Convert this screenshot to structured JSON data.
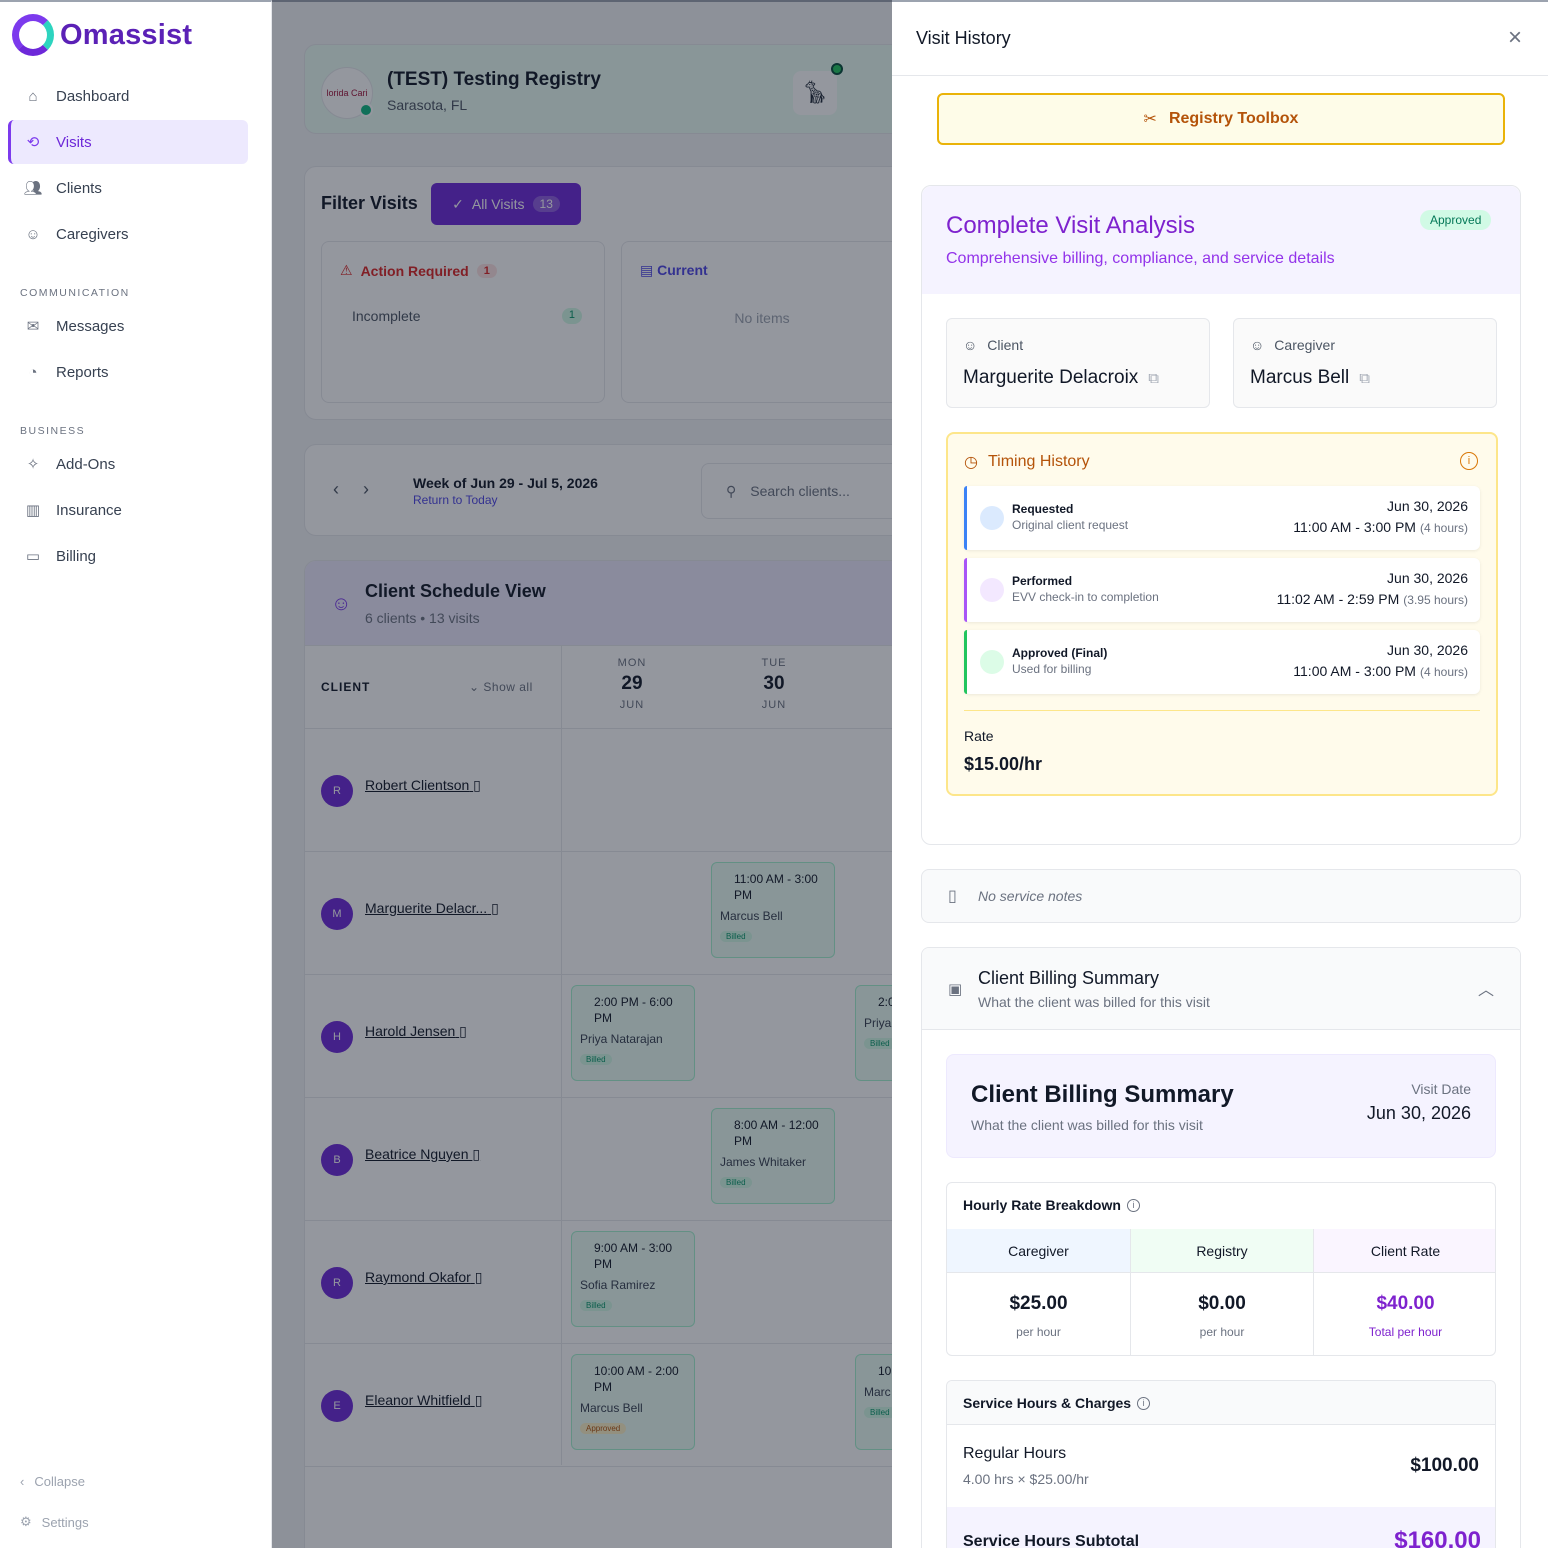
{
  "app": {
    "name": "Omassist"
  },
  "sidebar": {
    "items": [
      {
        "label": "Dashboard",
        "icon": "home-icon"
      },
      {
        "label": "Visits",
        "icon": "refresh-icon"
      },
      {
        "label": "Clients",
        "icon": "users-icon"
      },
      {
        "label": "Caregivers",
        "icon": "user-icon"
      }
    ],
    "communication_label": "COMMUNICATION",
    "communication_items": [
      {
        "label": "Messages",
        "icon": "inbox-icon"
      },
      {
        "label": "Reports",
        "icon": "pie-chart-icon"
      }
    ],
    "business_label": "BUSINESS",
    "business_items": [
      {
        "label": "Add-Ons",
        "icon": "sparkles-icon"
      },
      {
        "label": "Insurance",
        "icon": "building-icon"
      },
      {
        "label": "Billing",
        "icon": "credit-card-icon"
      }
    ],
    "collapse_label": "Collapse",
    "settings_label": "Settings"
  },
  "registry": {
    "name": "(TEST) Testing Registry",
    "location": "Sarasota, FL",
    "logo_text": "lorida Cari"
  },
  "filter": {
    "title": "Filter Visits",
    "all_visits_label": "All Visits",
    "all_visits_count": "13",
    "action_required_label": "Action Required",
    "action_required_count": "1",
    "incomplete_label": "Incomplete",
    "incomplete_count": "1",
    "current_label": "Current",
    "current_empty": "No items"
  },
  "week": {
    "title": "Week of Jun 29 - Jul 5, 2026",
    "return_link": "Return to Today",
    "search_placeholder": "Search clients..."
  },
  "schedule": {
    "title": "Client Schedule View",
    "subtitle": "6 clients • 13 visits",
    "client_col": "CLIENT",
    "show_all": "Show all",
    "days": [
      {
        "dow": "MON",
        "num": "29",
        "mon": "JUN"
      },
      {
        "dow": "TUE",
        "num": "30",
        "mon": "JUN"
      }
    ],
    "clients": [
      {
        "initial": "R",
        "name": "Robert Clientson"
      },
      {
        "initial": "M",
        "name": "Marguerite Delacr..."
      },
      {
        "initial": "H",
        "name": "Harold Jensen"
      },
      {
        "initial": "B",
        "name": "Beatrice Nguyen"
      },
      {
        "initial": "R",
        "name": "Raymond Okafor"
      },
      {
        "initial": "E",
        "name": "Eleanor Whitfield"
      }
    ],
    "visits": [
      {
        "time": "11:00 AM - 3:00 PM",
        "caregiver": "Marcus Bell",
        "status": "Billed"
      },
      {
        "time": "2:00 PM - 6:00 PM",
        "caregiver": "Priya Natarajan",
        "status": "Billed"
      },
      {
        "time": "2:0 PM",
        "caregiver": "Priya",
        "status": "Billed"
      },
      {
        "time": "8:00 AM - 12:00 PM",
        "caregiver": "James Whitaker",
        "status": "Billed"
      },
      {
        "time": "9:00 AM - 3:00 PM",
        "caregiver": "Sofia Ramirez",
        "status": "Billed"
      },
      {
        "time": "10:00 AM - 2:00 PM",
        "caregiver": "Marcus Bell",
        "status": "Approved"
      },
      {
        "time": "10 2:0",
        "caregiver": "Marc",
        "status": "Billed"
      }
    ]
  },
  "panel": {
    "title": "Visit History",
    "toolbox_label": "Registry Toolbox",
    "analysis": {
      "title": "Complete Visit Analysis",
      "subtitle": "Comprehensive billing, compliance, and service details",
      "status": "Approved",
      "client_label": "Client",
      "client_name": "Marguerite Delacroix",
      "caregiver_label": "Caregiver",
      "caregiver_name": "Marcus Bell"
    },
    "timing": {
      "title": "Timing History",
      "rows": [
        {
          "name": "Requested",
          "desc": "Original client request",
          "date": "Jun 30, 2026",
          "time": "11:00 AM - 3:00 PM",
          "hours": "(4 hours)",
          "color": "#3b82f6"
        },
        {
          "name": "Performed",
          "desc": "EVV check-in to completion",
          "date": "Jun 30, 2026",
          "time": "11:02 AM - 2:59 PM",
          "hours": "(3.95 hours)",
          "color": "#a855f7"
        },
        {
          "name": "Approved (Final)",
          "desc": "Used for billing",
          "date": "Jun 30, 2026",
          "time": "11:00 AM - 3:00 PM",
          "hours": "(4 hours)",
          "color": "#22c55e"
        }
      ],
      "rate_label": "Rate",
      "rate_value": "$15.00/hr"
    },
    "notes": "No service notes",
    "billing": {
      "header_title": "Client Billing Summary",
      "header_sub": "What the client was billed for this visit",
      "card_title": "Client Billing Summary",
      "card_sub": "What the client was billed for this visit",
      "visit_date_label": "Visit Date",
      "visit_date": "Jun 30, 2026",
      "hourly_title": "Hourly Rate Breakdown",
      "hourly_cols": [
        {
          "label": "Caregiver",
          "value": "$25.00",
          "unit": "per hour"
        },
        {
          "label": "Registry",
          "value": "$0.00",
          "unit": "per hour"
        },
        {
          "label": "Client Rate",
          "value": "$40.00",
          "unit": "Total per hour"
        }
      ],
      "service_title": "Service Hours & Charges",
      "regular_label": "Regular Hours",
      "regular_calc": "4.00 hrs × $25.00/hr",
      "regular_amount": "$100.00",
      "subtotal_label": "Service Hours Subtotal",
      "subtotal_amount": "$160.00"
    }
  }
}
